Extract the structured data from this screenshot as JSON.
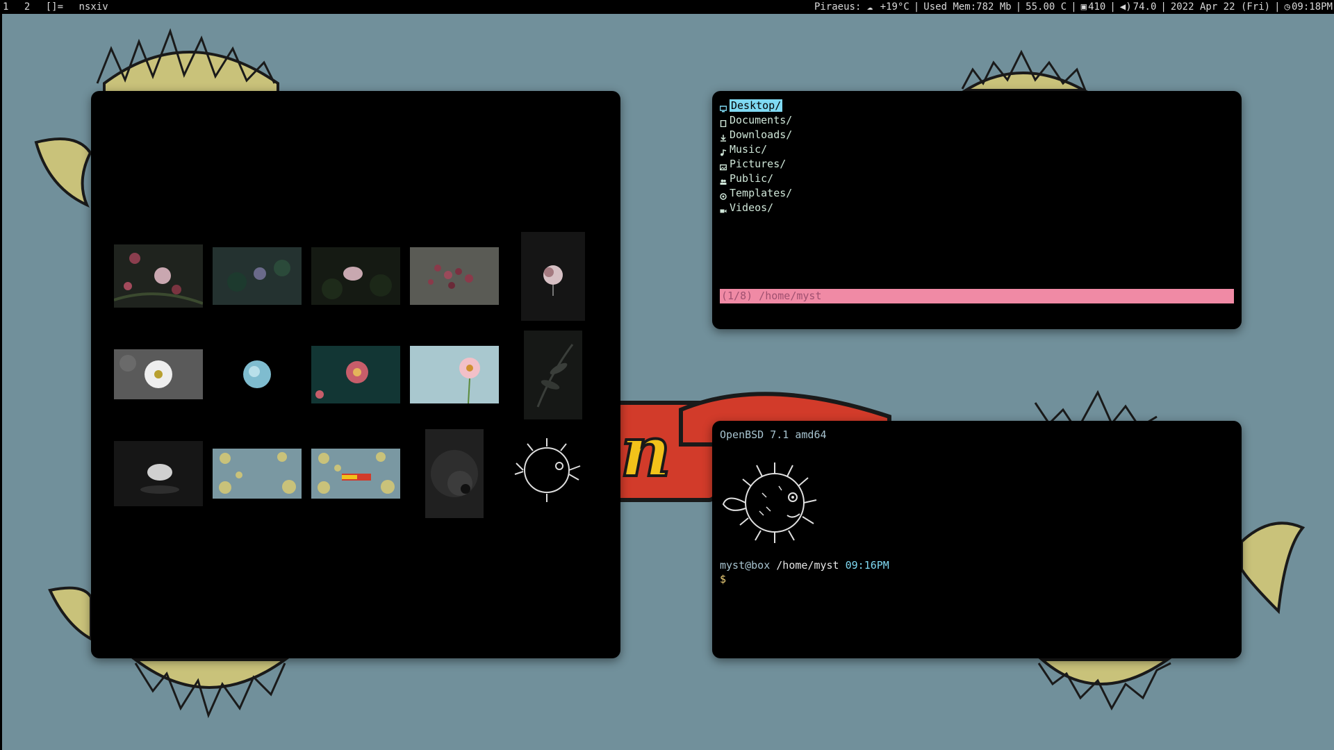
{
  "topbar": {
    "workspaces": [
      "1",
      "2"
    ],
    "layout": "[]=",
    "window_title": "nsxiv",
    "weather_location": "Piraeus:",
    "weather_icon": "cloud-icon",
    "temperature": "+19°C",
    "memory": "Used Mem:782 Mb",
    "cpu_temp": "55.00 C",
    "battery_icon": "battery-icon",
    "battery": "410",
    "volume_icon": "speaker-icon",
    "volume": "74.0",
    "date": "2022 Apr 22 (Fri)",
    "clock_icon": "clock-icon",
    "time": "09:18PM"
  },
  "colors": {
    "desktop_bg": "#71909b",
    "window_bg": "#000000",
    "selection": "#7fd9f2",
    "statusline": "#f08aa5",
    "folder_text": "#cfe6d8"
  },
  "file_manager": {
    "items": [
      {
        "name": "Desktop/",
        "icon": "desktop-icon",
        "selected": true
      },
      {
        "name": "Documents/",
        "icon": "document-icon",
        "selected": false
      },
      {
        "name": "Downloads/",
        "icon": "download-icon",
        "selected": false
      },
      {
        "name": "Music/",
        "icon": "music-icon",
        "selected": false
      },
      {
        "name": "Pictures/",
        "icon": "picture-icon",
        "selected": false
      },
      {
        "name": "Public/",
        "icon": "users-icon",
        "selected": false
      },
      {
        "name": "Templates/",
        "icon": "template-icon",
        "selected": false
      },
      {
        "name": "Videos/",
        "icon": "video-icon",
        "selected": false
      }
    ],
    "status": "(1/8) /home/myst"
  },
  "terminal": {
    "system": "OpenBSD 7.1 amd64",
    "user_host": "myst@box",
    "cwd": "/home/myst",
    "time": "09:16PM",
    "prompt": "$"
  },
  "nsxiv": {
    "thumbnails": [
      {
        "name": "flower-thumbnail"
      },
      {
        "name": "flower-thumbnail"
      },
      {
        "name": "flower-thumbnail"
      },
      {
        "name": "flower-thumbnail"
      },
      {
        "name": "flower-thumbnail"
      },
      {
        "name": "flower-thumbnail"
      },
      {
        "name": "flower-thumbnail"
      },
      {
        "name": "flower-thumbnail"
      },
      {
        "name": "flower-thumbnail"
      },
      {
        "name": "leaf-thumbnail"
      },
      {
        "name": "lotus-thumbnail"
      },
      {
        "name": "pufferfish-wallpaper-thumbnail"
      },
      {
        "name": "openbsd-wallpaper-thumbnail"
      },
      {
        "name": "shell-thumbnail"
      },
      {
        "name": "pufferfish-logo-thumbnail"
      }
    ]
  }
}
